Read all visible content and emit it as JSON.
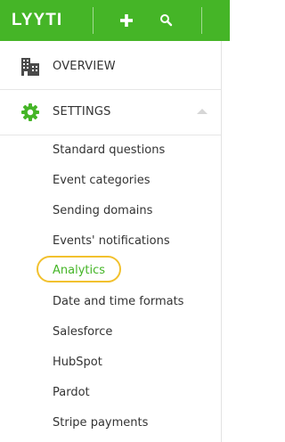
{
  "app": {
    "logo_text": "LYYTI",
    "brand_color": "#45b527",
    "highlight_color": "#f2c12e"
  },
  "toolbar": {
    "add_icon": "plus-icon",
    "search_icon": "search-icon"
  },
  "menu": {
    "overview": {
      "label": "OVERVIEW",
      "icon": "building-icon"
    },
    "settings": {
      "label": "SETTINGS",
      "icon": "gear-icon",
      "expanded": true
    },
    "settings_items": [
      {
        "label": "Standard questions"
      },
      {
        "label": "Event categories"
      },
      {
        "label": "Sending domains"
      },
      {
        "label": "Events' notifications"
      },
      {
        "label": "Analytics",
        "active": true
      },
      {
        "label": "Date and time formats"
      },
      {
        "label": "Salesforce"
      },
      {
        "label": "HubSpot"
      },
      {
        "label": "Pardot"
      },
      {
        "label": "Stripe payments"
      }
    ]
  }
}
